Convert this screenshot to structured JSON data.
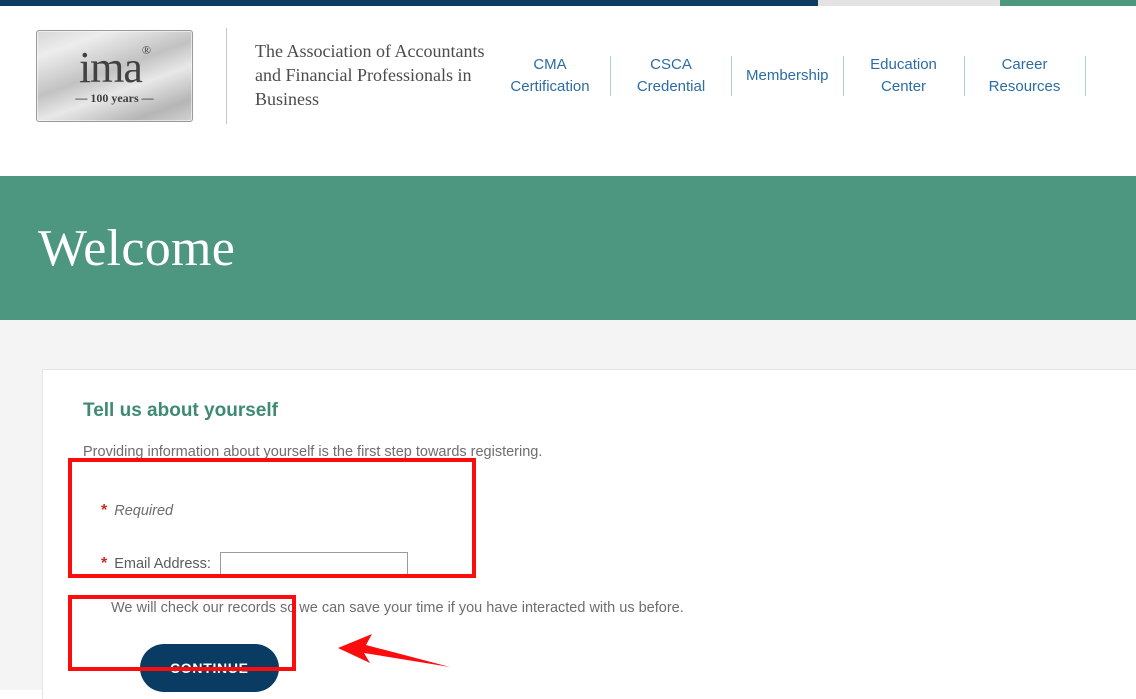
{
  "topbar": {
    "segments": [
      {
        "name": "navy",
        "color": "#0c3c60"
      },
      {
        "name": "gray",
        "color": "#e3e3e3"
      },
      {
        "name": "green",
        "color": "#4d9680"
      }
    ]
  },
  "header": {
    "logo": {
      "wordmark": "ima",
      "registered": "®",
      "anniversary": "— 100 years —"
    },
    "tagline": "The Association of Accountants and Financial Professionals in Business",
    "nav": [
      {
        "label": "CMA Certification"
      },
      {
        "label": "CSCA Credential"
      },
      {
        "label": "Membership"
      },
      {
        "label": "Education Center"
      },
      {
        "label": "Career Resources"
      }
    ]
  },
  "banner": {
    "title": "Welcome",
    "background": "#4d9680"
  },
  "form": {
    "heading": "Tell us about yourself",
    "subheading": "Providing information about yourself is the first step towards registering.",
    "required_note": "Required",
    "required_marker": "*",
    "email_label": "Email Address:",
    "email_value": "",
    "email_placeholder": "",
    "records_note": "We will check our records so we can save your time if you have interacted with us before.",
    "continue_label": "CONTINUE",
    "continue_color": "#0a3b63"
  },
  "annotations": {
    "highlight_color": "#fb0d0d",
    "boxes": [
      {
        "name": "email-section-highlight"
      },
      {
        "name": "continue-button-highlight"
      }
    ],
    "arrow": {
      "name": "pointer-arrow",
      "direction": "left"
    }
  }
}
